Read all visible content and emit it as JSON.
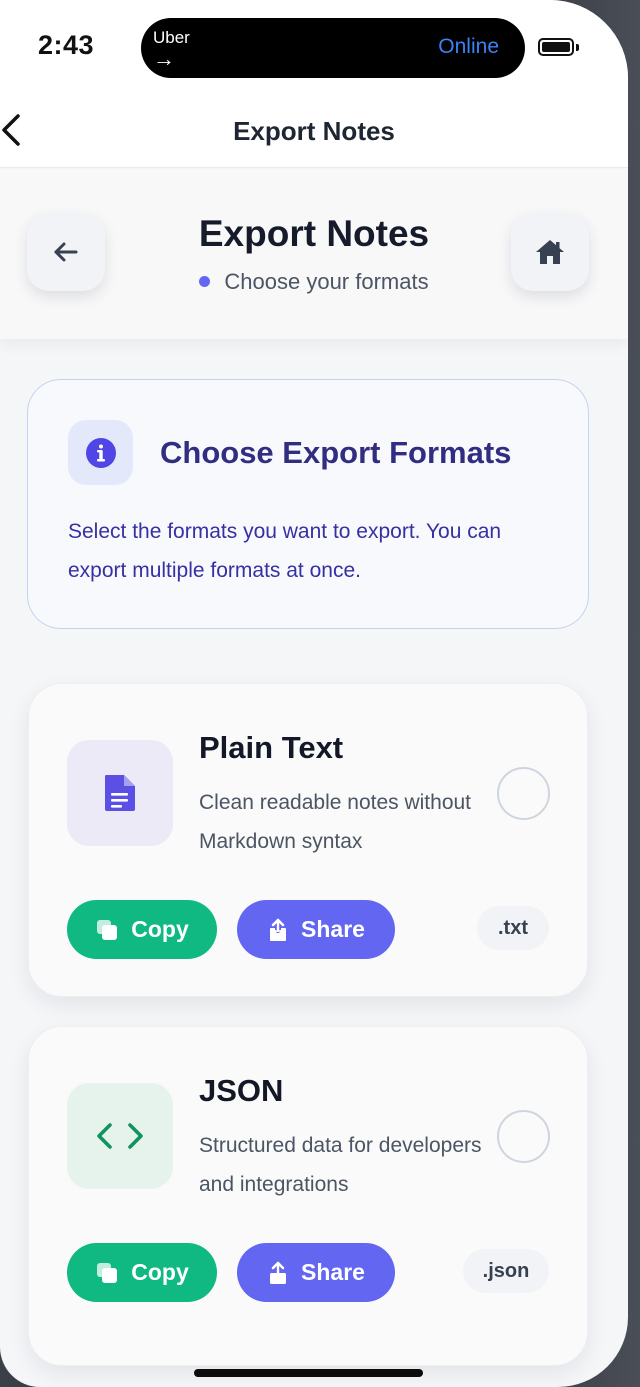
{
  "status_bar": {
    "time": "2:43",
    "island_app": "Uber",
    "island_arrow": "→",
    "island_status": "Online"
  },
  "nav": {
    "title": "Export Notes"
  },
  "header": {
    "title": "Export Notes",
    "subtitle": "Choose your formats"
  },
  "info": {
    "title": "Choose Export Formats",
    "description": "Select the formats you want to export. You can export multiple formats at once."
  },
  "formats": [
    {
      "name": "Plain Text",
      "description": "Clean readable notes without Markdown syntax",
      "icon": "document-icon",
      "copy_label": "Copy",
      "share_label": "Share",
      "extension": ".txt",
      "selected": false
    },
    {
      "name": "JSON",
      "description": "Structured data for developers and integrations",
      "icon": "code-icon",
      "copy_label": "Copy",
      "share_label": "Share",
      "extension": ".json",
      "selected": false
    }
  ],
  "colors": {
    "accent": "#6366f1",
    "copy_green": "#10b981",
    "info_text": "#312e81",
    "island_online": "#3b82f6"
  }
}
